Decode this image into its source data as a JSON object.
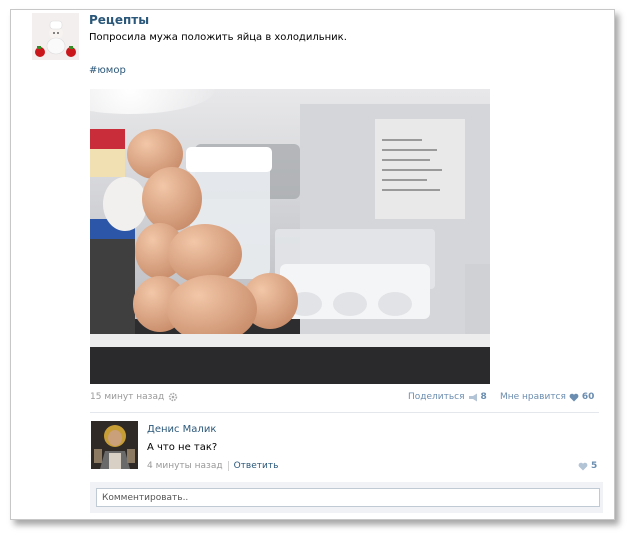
{
  "post": {
    "group_name": "Рецепты",
    "text": "Попросила мужа положить яйца в холодильник.",
    "hashtag": "#юмор",
    "time": "15 минут назад",
    "share_label": "Поделиться",
    "share_count": "8",
    "like_label": "Мне нравится",
    "like_count": "60"
  },
  "comment": {
    "author": "Денис Малик",
    "text": "А что не так?",
    "time": "4 минуты назад",
    "reply_label": "Ответить",
    "like_count": "5"
  },
  "comment_box": {
    "placeholder": "Комментировать.."
  },
  "icons": {
    "settings": "gear-icon",
    "share": "megaphone-icon",
    "like": "heart-icon"
  },
  "colors": {
    "link": "#2b587a",
    "muted_link": "#6b8db0",
    "muted_text": "#999999"
  }
}
